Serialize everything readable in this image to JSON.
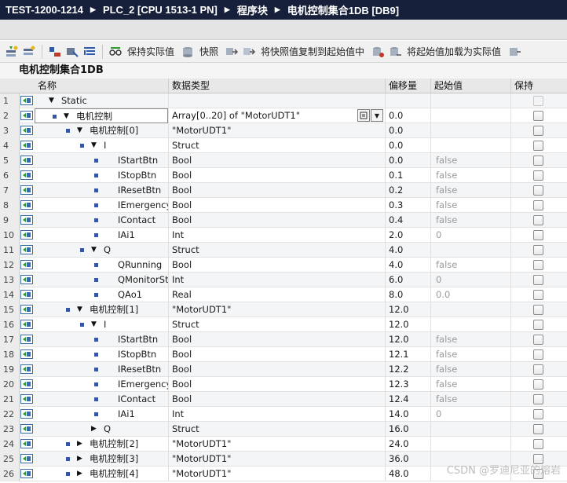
{
  "breadcrumb": [
    "TEST-1200-1214",
    "PLC_2 [CPU 1513-1 PN]",
    "程序块",
    "电机控制集合1DB [DB9]"
  ],
  "toolbar": {
    "keep_actual_label": "保持实际值",
    "snapshot_label": "快照",
    "copy_snapshot_label": "将快照值复制到起始值中",
    "load_start_label": "将起始值加载为实际值"
  },
  "db_title": "电机控制集合1DB",
  "columns": {
    "name": "名称",
    "datatype": "数据类型",
    "offset": "偏移量",
    "start": "起始值",
    "retain": "保持"
  },
  "rows": [
    {
      "n": "1",
      "name": "Static",
      "indent": 0,
      "arrow": "down",
      "bullet": false,
      "type": "",
      "offset": "",
      "start": "",
      "retain_dim": true
    },
    {
      "n": "2",
      "name": "电机控制",
      "indent": 1,
      "arrow": "down",
      "bullet": true,
      "type": "Array[0..20] of \"MotorUDT1\"",
      "offset": "0.0",
      "start": "",
      "selected": true
    },
    {
      "n": "3",
      "name": "电机控制[0]",
      "indent": 2,
      "arrow": "down",
      "bullet": true,
      "type": "\"MotorUDT1\"",
      "offset": "0.0",
      "start": ""
    },
    {
      "n": "4",
      "name": "I",
      "indent": 3,
      "arrow": "down",
      "bullet": true,
      "type": "Struct",
      "offset": "0.0",
      "start": ""
    },
    {
      "n": "5",
      "name": "IStartBtn",
      "indent": 4,
      "arrow": "",
      "bullet": true,
      "type": "Bool",
      "offset": "0.0",
      "start": "false"
    },
    {
      "n": "6",
      "name": "IStopBtn",
      "indent": 4,
      "arrow": "",
      "bullet": true,
      "type": "Bool",
      "offset": "0.1",
      "start": "false"
    },
    {
      "n": "7",
      "name": "IResetBtn",
      "indent": 4,
      "arrow": "",
      "bullet": true,
      "type": "Bool",
      "offset": "0.2",
      "start": "false"
    },
    {
      "n": "8",
      "name": "IEmergency...",
      "indent": 4,
      "arrow": "",
      "bullet": true,
      "type": "Bool",
      "offset": "0.3",
      "start": "false"
    },
    {
      "n": "9",
      "name": "IContact",
      "indent": 4,
      "arrow": "",
      "bullet": true,
      "type": "Bool",
      "offset": "0.4",
      "start": "false"
    },
    {
      "n": "10",
      "name": "IAi1",
      "indent": 4,
      "arrow": "",
      "bullet": true,
      "type": "Int",
      "offset": "2.0",
      "start": "0"
    },
    {
      "n": "11",
      "name": "Q",
      "indent": 3,
      "arrow": "down",
      "bullet": true,
      "type": "Struct",
      "offset": "4.0",
      "start": ""
    },
    {
      "n": "12",
      "name": "QRunning",
      "indent": 4,
      "arrow": "",
      "bullet": true,
      "type": "Bool",
      "offset": "4.0",
      "start": "false"
    },
    {
      "n": "13",
      "name": "QMonitorSt...",
      "indent": 4,
      "arrow": "",
      "bullet": true,
      "type": "Int",
      "offset": "6.0",
      "start": "0"
    },
    {
      "n": "14",
      "name": "QAo1",
      "indent": 4,
      "arrow": "",
      "bullet": true,
      "type": "Real",
      "offset": "8.0",
      "start": "0.0"
    },
    {
      "n": "15",
      "name": "电机控制[1]",
      "indent": 2,
      "arrow": "down",
      "bullet": true,
      "type": "\"MotorUDT1\"",
      "offset": "12.0",
      "start": ""
    },
    {
      "n": "16",
      "name": "I",
      "indent": 3,
      "arrow": "down",
      "bullet": true,
      "type": "Struct",
      "offset": "12.0",
      "start": ""
    },
    {
      "n": "17",
      "name": "IStartBtn",
      "indent": 4,
      "arrow": "",
      "bullet": true,
      "type": "Bool",
      "offset": "12.0",
      "start": "false"
    },
    {
      "n": "18",
      "name": "IStopBtn",
      "indent": 4,
      "arrow": "",
      "bullet": true,
      "type": "Bool",
      "offset": "12.1",
      "start": "false"
    },
    {
      "n": "19",
      "name": "IResetBtn",
      "indent": 4,
      "arrow": "",
      "bullet": true,
      "type": "Bool",
      "offset": "12.2",
      "start": "false"
    },
    {
      "n": "20",
      "name": "IEmergency...",
      "indent": 4,
      "arrow": "",
      "bullet": true,
      "type": "Bool",
      "offset": "12.3",
      "start": "false"
    },
    {
      "n": "21",
      "name": "IContact",
      "indent": 4,
      "arrow": "",
      "bullet": true,
      "type": "Bool",
      "offset": "12.4",
      "start": "false"
    },
    {
      "n": "22",
      "name": "IAi1",
      "indent": 4,
      "arrow": "",
      "bullet": true,
      "type": "Int",
      "offset": "14.0",
      "start": "0"
    },
    {
      "n": "23",
      "name": "Q",
      "indent": 3,
      "arrow": "right",
      "bullet": false,
      "type": "Struct",
      "offset": "16.0",
      "start": ""
    },
    {
      "n": "24",
      "name": "电机控制[2]",
      "indent": 2,
      "arrow": "right",
      "bullet": true,
      "type": "\"MotorUDT1\"",
      "offset": "24.0",
      "start": ""
    },
    {
      "n": "25",
      "name": "电机控制[3]",
      "indent": 2,
      "arrow": "right",
      "bullet": true,
      "type": "\"MotorUDT1\"",
      "offset": "36.0",
      "start": ""
    },
    {
      "n": "26",
      "name": "电机控制[4]",
      "indent": 2,
      "arrow": "right",
      "bullet": true,
      "type": "\"MotorUDT1\"",
      "offset": "48.0",
      "start": ""
    }
  ],
  "watermark": "CSDN @罗迪尼亚的熔岩",
  "colors": {
    "breadcrumb_bg": "#16203a",
    "row_odd": "#f3f5f7",
    "bullet": "#3556a6",
    "start_gray": "#9a9a9a"
  }
}
